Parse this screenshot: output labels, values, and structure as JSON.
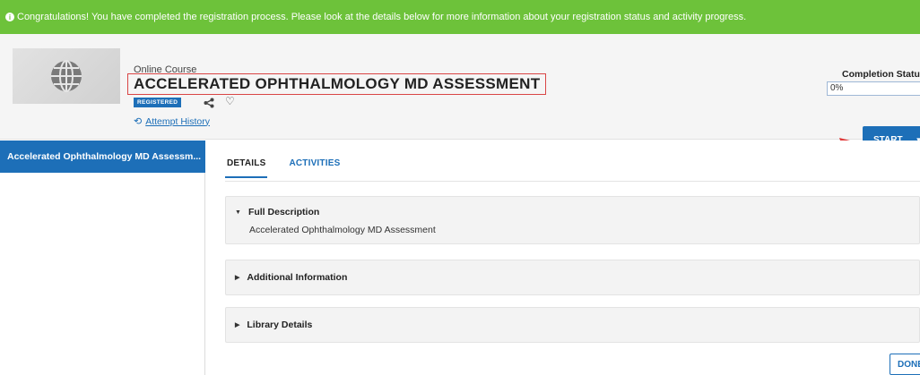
{
  "banner": {
    "text": "Congratulations! You have completed the registration process. Please look at the details below for more information about your registration status and activity progress.",
    "color": "#6dc23a"
  },
  "course": {
    "type": "Online Course",
    "title": "ACCELERATED OPHTHALMOLOGY MD ASSESSMENT",
    "badge": "REGISTERED",
    "attempt_history": "Attempt History",
    "thumbnail_icon": "globe-icon"
  },
  "completion": {
    "label": "Completion Status",
    "value": "0%"
  },
  "actions": {
    "start_label": "START",
    "done_label": "DONE"
  },
  "sidebar": {
    "items": [
      {
        "label": "Accelerated Ophthalmology MD Assessm..."
      }
    ]
  },
  "tabs": [
    {
      "label": "DETAILS",
      "active": true
    },
    {
      "label": "ACTIVITIES",
      "active": false
    }
  ],
  "sections": [
    {
      "title": "Full Description",
      "expanded": true,
      "content": "Accelerated Ophthalmology MD Assessment"
    },
    {
      "title": "Additional Information",
      "expanded": false
    },
    {
      "title": "Library Details",
      "expanded": false
    }
  ],
  "colors": {
    "primary": "#1d6fb8",
    "highlight": "#d94545",
    "success": "#6dc23a"
  }
}
